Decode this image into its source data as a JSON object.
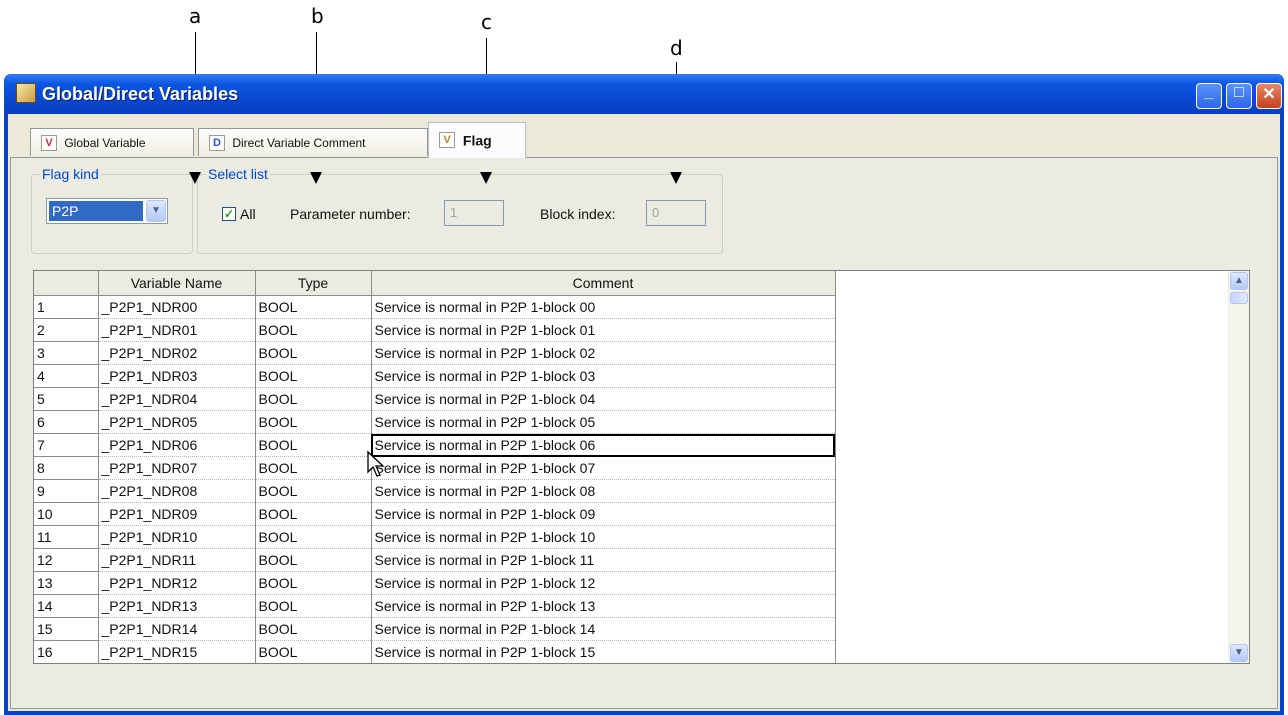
{
  "callouts": [
    "a",
    "b",
    "c",
    "d"
  ],
  "window": {
    "title": "Global/Direct Variables",
    "minimize": "_",
    "maximize": "□",
    "close": "✕"
  },
  "tabs": [
    {
      "icon": "V",
      "label": "Global Variable"
    },
    {
      "icon": "D",
      "label": "Direct Variable Comment"
    },
    {
      "icon": "V",
      "label": "Flag"
    }
  ],
  "flag_kind": {
    "title": "Flag kind",
    "value": "P2P"
  },
  "select_list": {
    "title": "Select list",
    "all_label": "All",
    "all_checked": true,
    "param_label": "Parameter number:",
    "param_value": "1",
    "block_label": "Block index:",
    "block_value": "0"
  },
  "grid": {
    "columns": [
      "",
      "Variable Name",
      "Type",
      "Comment"
    ],
    "rows": [
      [
        "1",
        "_P2P1_NDR00",
        "BOOL",
        "Service is normal in P2P 1-block 00"
      ],
      [
        "2",
        "_P2P1_NDR01",
        "BOOL",
        "Service is normal in P2P 1-block 01"
      ],
      [
        "3",
        "_P2P1_NDR02",
        "BOOL",
        "Service is normal in P2P 1-block 02"
      ],
      [
        "4",
        "_P2P1_NDR03",
        "BOOL",
        "Service is normal in P2P 1-block 03"
      ],
      [
        "5",
        "_P2P1_NDR04",
        "BOOL",
        "Service is normal in P2P 1-block 04"
      ],
      [
        "6",
        "_P2P1_NDR05",
        "BOOL",
        "Service is normal in P2P 1-block 05"
      ],
      [
        "7",
        "_P2P1_NDR06",
        "BOOL",
        "Service is normal in P2P 1-block 06"
      ],
      [
        "8",
        "_P2P1_NDR07",
        "BOOL",
        "Service is normal in P2P 1-block 07"
      ],
      [
        "9",
        "_P2P1_NDR08",
        "BOOL",
        "Service is normal in P2P 1-block 08"
      ],
      [
        "10",
        "_P2P1_NDR09",
        "BOOL",
        "Service is normal in P2P 1-block 09"
      ],
      [
        "11",
        "_P2P1_NDR10",
        "BOOL",
        "Service is normal in P2P 1-block 10"
      ],
      [
        "12",
        "_P2P1_NDR11",
        "BOOL",
        "Service is normal in P2P 1-block 11"
      ],
      [
        "13",
        "_P2P1_NDR12",
        "BOOL",
        "Service is normal in P2P 1-block 12"
      ],
      [
        "14",
        "_P2P1_NDR13",
        "BOOL",
        "Service is normal in P2P 1-block 13"
      ],
      [
        "15",
        "_P2P1_NDR14",
        "BOOL",
        "Service is normal in P2P 1-block 14"
      ],
      [
        "16",
        "_P2P1_NDR15",
        "BOOL",
        "Service is normal in P2P 1-block 15"
      ]
    ]
  }
}
